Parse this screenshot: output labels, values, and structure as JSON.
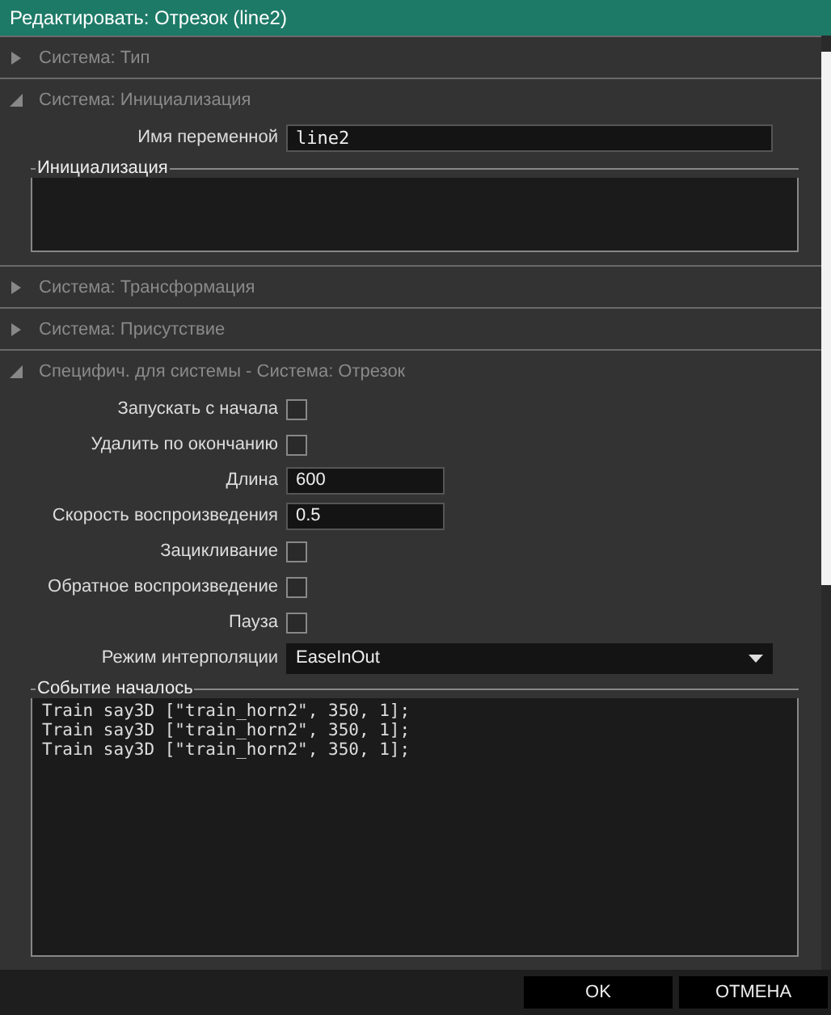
{
  "window": {
    "title": "Редактировать: Отрезок (line2)"
  },
  "sections": [
    {
      "title": "Система: Тип",
      "expanded": false
    },
    {
      "title": "Система: Инициализация",
      "expanded": true,
      "fields": [
        {
          "kind": "code-field",
          "label": "Имя переменной",
          "value": "line2"
        },
        {
          "kind": "textarea",
          "legend": "Инициализация"
        }
      ]
    },
    {
      "title": "Система: Трансформация",
      "expanded": false
    },
    {
      "title": "Система: Присутствие",
      "expanded": false
    },
    {
      "title": "Специфич. для системы - Система: Отрезок",
      "expanded": true,
      "fields": [
        {
          "kind": "checkbox",
          "label": "Запускать с начала",
          "checked": false
        },
        {
          "kind": "checkbox",
          "label": "Удалить по окончанию",
          "checked": false
        },
        {
          "kind": "text",
          "label": "Длина",
          "value": "600"
        },
        {
          "kind": "text",
          "label": "Скорость воспроизведения",
          "value": "0.5"
        },
        {
          "kind": "checkbox",
          "label": "Зацикливание",
          "checked": false
        },
        {
          "kind": "checkbox",
          "label": "Обратное воспроизведение",
          "checked": false
        },
        {
          "kind": "checkbox",
          "label": "Пауза",
          "checked": false
        },
        {
          "kind": "dropdown",
          "label": "Режим интерполяции",
          "value": "EaseInOut"
        },
        {
          "kind": "textarea",
          "legend": "Событие началось",
          "lines": [
            "Train say3D [\"train_horn2\", 350, 1];",
            "Train say3D [\"train_horn2\", 350, 1];",
            "Train say3D [\"train_horn2\", 350, 1];"
          ]
        }
      ]
    }
  ],
  "buttons": [
    {
      "label": "OK"
    },
    {
      "label": "ОТМЕНА"
    }
  ]
}
